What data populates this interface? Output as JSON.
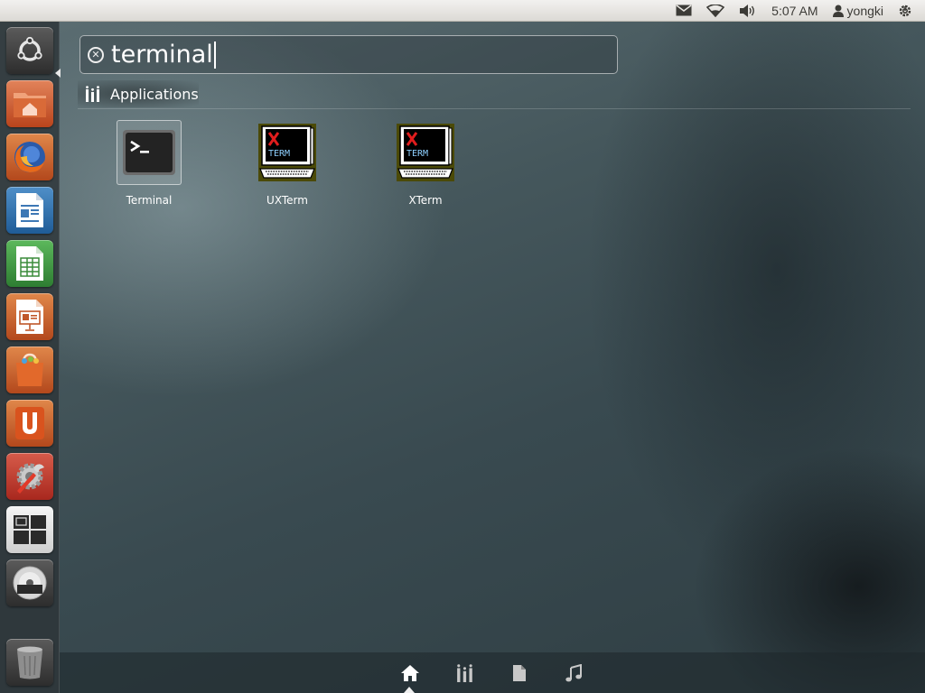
{
  "top_panel": {
    "icons": [
      "mail-icon",
      "wifi-icon",
      "volume-icon"
    ],
    "time": "5:07 AM",
    "username": "yongki",
    "session_icon": "gear-power-icon"
  },
  "launcher": {
    "items": [
      {
        "name": "dash-home",
        "icon": "ubuntu-logo-icon"
      },
      {
        "name": "home-folder",
        "icon": "home-folder-icon"
      },
      {
        "name": "firefox",
        "icon": "firefox-icon"
      },
      {
        "name": "libreoffice-writer",
        "icon": "writer-icon"
      },
      {
        "name": "libreoffice-calc",
        "icon": "calc-icon"
      },
      {
        "name": "libreoffice-impress",
        "icon": "impress-icon"
      },
      {
        "name": "software-center",
        "icon": "shopping-bag-icon"
      },
      {
        "name": "ubuntu-one",
        "icon": "ubuntu-one-icon"
      },
      {
        "name": "system-settings",
        "icon": "settings-icon"
      },
      {
        "name": "workspace-switcher",
        "icon": "workspaces-icon"
      },
      {
        "name": "dvd",
        "icon": "dvd-icon"
      },
      {
        "name": "trash",
        "icon": "trash-icon"
      }
    ]
  },
  "search": {
    "query": "terminal"
  },
  "category": {
    "label": "Applications"
  },
  "results": [
    {
      "label": "Terminal",
      "icon": "terminal-icon",
      "selected": true
    },
    {
      "label": "UXTerm",
      "icon": "xterm-icon",
      "selected": false
    },
    {
      "label": "XTerm",
      "icon": "xterm-icon",
      "selected": false
    }
  ],
  "lenses": [
    "home-lens-icon",
    "applications-lens-icon",
    "files-lens-icon",
    "music-lens-icon"
  ],
  "colors": {
    "ubuntu_orange": "#dd4814",
    "panel_bg": "#e7e5e0"
  }
}
